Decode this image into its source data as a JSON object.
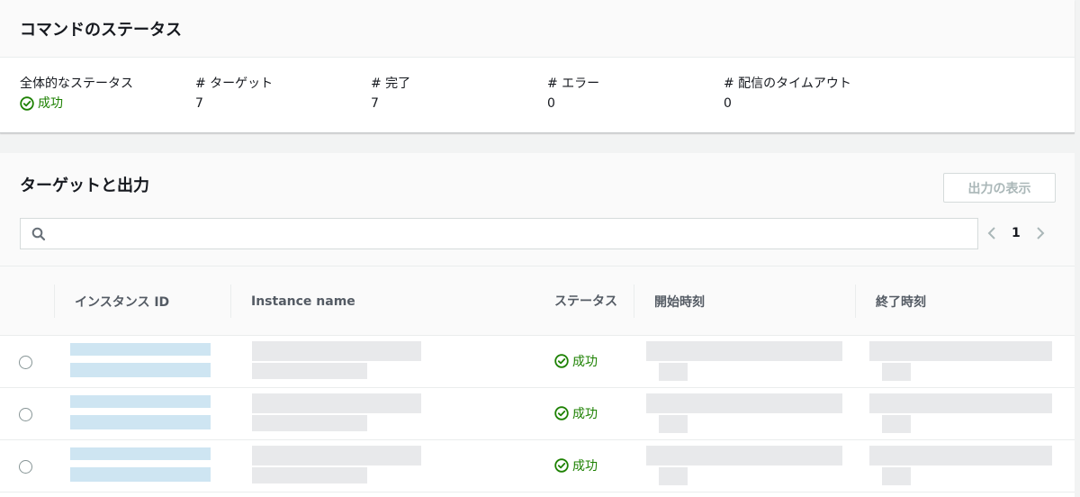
{
  "command_status": {
    "title": "コマンドのステータス",
    "overall_label": "全体的なステータス",
    "overall_value": "成功",
    "targets_label": "# ターゲット",
    "targets_value": "7",
    "completed_label": "# 完了",
    "completed_value": "7",
    "errors_label": "# エラー",
    "errors_value": "0",
    "timeout_label": "# 配信のタイムアウト",
    "timeout_value": "0"
  },
  "targets": {
    "title": "ターゲットと出力",
    "view_output_label": "出力の表示",
    "search_placeholder": "",
    "page": "1",
    "columns": [
      "インスタンス ID",
      "Instance name",
      "ステータス",
      "開始時刻",
      "終了時刻"
    ],
    "rows": [
      {
        "status": "成功"
      },
      {
        "status": "成功"
      },
      {
        "status": "成功"
      }
    ]
  },
  "colors": {
    "success": "#1d8102",
    "link_blur": "#c5e0f0",
    "gray_blur": "#e4e5e7"
  }
}
